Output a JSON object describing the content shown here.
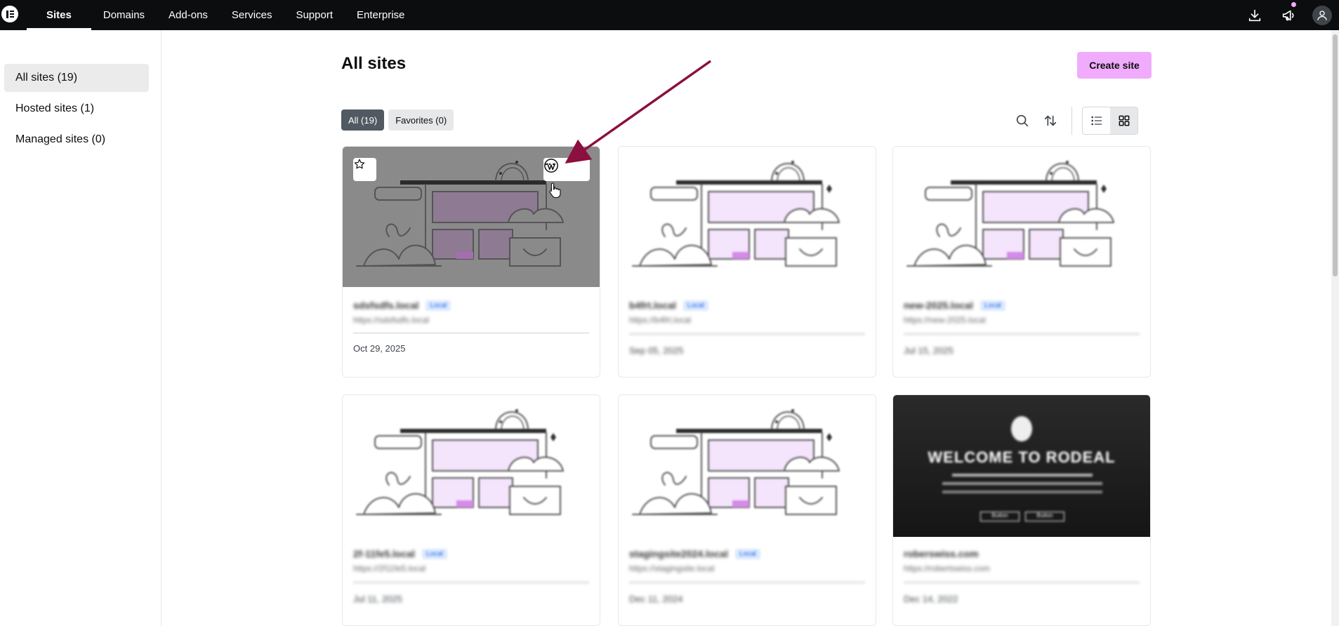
{
  "topbar": {
    "nav": [
      "Sites",
      "Domains",
      "Add-ons",
      "Services",
      "Support",
      "Enterprise"
    ],
    "active": "Sites",
    "icons": [
      "download-icon",
      "megaphone-icon",
      "user-avatar-icon"
    ],
    "notification_color": "#f0abfc"
  },
  "sidebar": {
    "items": [
      {
        "label": "All sites (19)",
        "active": true
      },
      {
        "label": "Hosted sites (1)",
        "active": false
      },
      {
        "label": "Managed sites (0)",
        "active": false
      }
    ]
  },
  "main": {
    "title": "All sites",
    "create_button": "Create site",
    "filters": [
      {
        "label": "All (19)",
        "active": true
      },
      {
        "label": "Favorites (0)",
        "active": false
      }
    ],
    "toolbar_icons": [
      "search-icon",
      "sort-icon",
      "list-view-icon",
      "grid-view-icon"
    ],
    "active_view": "grid"
  },
  "cards": [
    {
      "name": "sdsfsdfs.local",
      "badge": "Local",
      "url": "https://sdsfsdfs.local",
      "date": "Oct 29, 2025",
      "blurred": false,
      "hover": true
    },
    {
      "name": "b4frt.local",
      "badge": "Local",
      "url": "https://b4frt.local",
      "date": "Sep 05, 2025",
      "blurred": true
    },
    {
      "name": "new-2025.local",
      "badge": "Local",
      "url": "https://new-2025.local",
      "date": "Jul 15, 2025",
      "blurred": true
    },
    {
      "name": "2f-11fe5.local",
      "badge": "Local",
      "url": "https://2f11fe5.local",
      "date": "Jul 11, 2025",
      "blurred": true
    },
    {
      "name": "stagingsite2024.local",
      "badge": "Local",
      "url": "https://stagingsite.local",
      "date": "Dec 11, 2024",
      "blurred": true
    },
    {
      "name": "roberswiss.com",
      "badge": "",
      "url": "https://robertswiss.com",
      "date": "Dec 14, 2022",
      "blurred": true,
      "thumb_text": "WELCOME TO RODEAL",
      "thumb_buttons": [
        "Button",
        "Button"
      ]
    }
  ],
  "brand_colors": {
    "accent": "#f0abfc",
    "topbar": "#0c0d0e",
    "arrow": "#8b0f3f"
  }
}
